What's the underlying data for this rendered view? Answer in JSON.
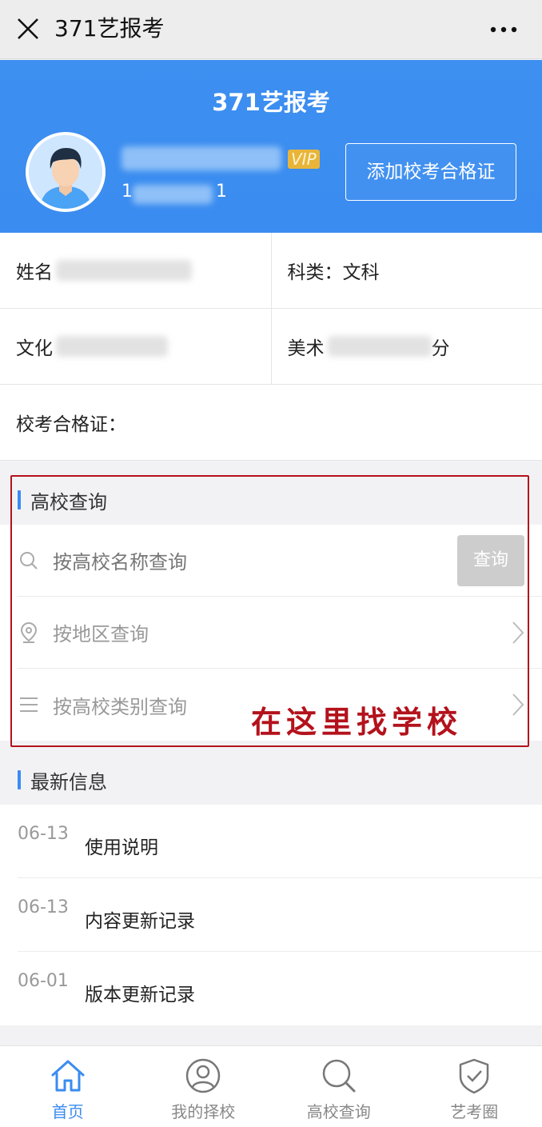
{
  "titlebar": {
    "title": "371艺报考"
  },
  "header": {
    "brand": "371艺报考",
    "vip_label": "VIP",
    "phone_prefix": "1",
    "phone_suffix": "1",
    "add_cert_label": "添加校考合格证"
  },
  "info": {
    "name_label": "姓名",
    "category_label": "科类：文科",
    "culture_label": "文化",
    "art_label": "美术",
    "art_suffix": "分",
    "cert_label": "校考合格证："
  },
  "school_search": {
    "section_title": "高校查询",
    "search_placeholder": "按高校名称查询",
    "search_button": "查询",
    "by_region": "按地区查询",
    "by_category": "按高校类别查询",
    "annotation": "在这里找学校"
  },
  "news": {
    "section_title": "最新信息",
    "items": [
      {
        "date": "06-13",
        "title": "使用说明"
      },
      {
        "date": "06-13",
        "title": "内容更新记录"
      },
      {
        "date": "06-01",
        "title": "版本更新记录"
      }
    ]
  },
  "tabbar": {
    "tabs": [
      {
        "label": "首页",
        "icon": "home-icon",
        "active": true
      },
      {
        "label": "我的择校",
        "icon": "user-icon",
        "active": false
      },
      {
        "label": "高校查询",
        "icon": "search-icon",
        "active": false
      },
      {
        "label": "艺考圈",
        "icon": "shield-check-icon",
        "active": false
      }
    ]
  },
  "colors": {
    "brand": "#3a8cf0",
    "annotation": "#b3121c",
    "vip": "#e8b53a"
  }
}
